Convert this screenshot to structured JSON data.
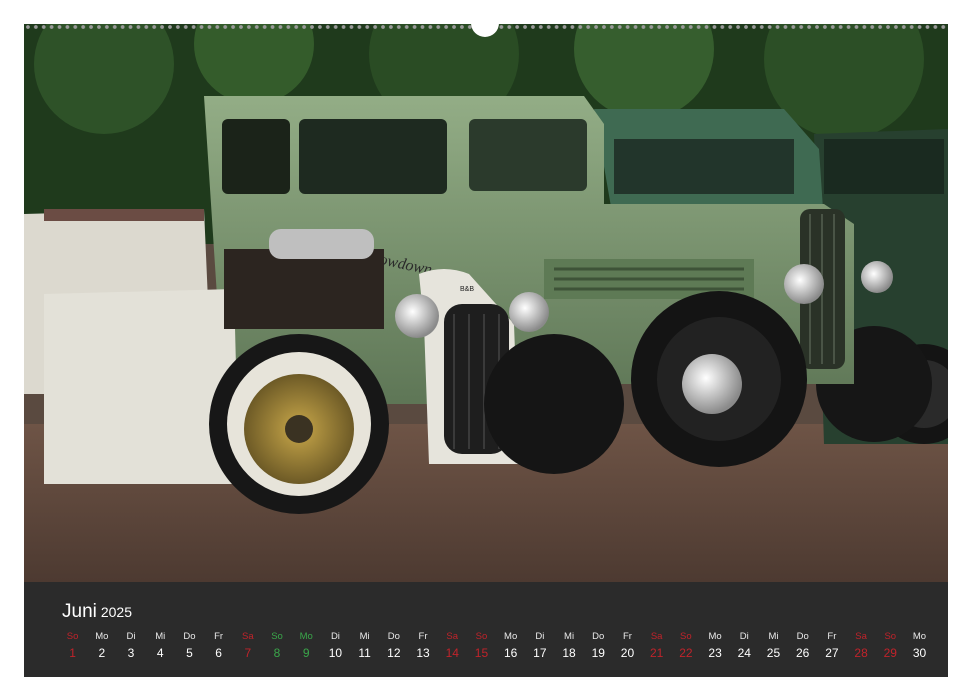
{
  "calendar": {
    "month": "Juni",
    "year": "2025",
    "days": [
      {
        "wd": "So",
        "d": "1",
        "kind": "sun"
      },
      {
        "wd": "Mo",
        "d": "2",
        "kind": "week"
      },
      {
        "wd": "Di",
        "d": "3",
        "kind": "week"
      },
      {
        "wd": "Mi",
        "d": "4",
        "kind": "week"
      },
      {
        "wd": "Do",
        "d": "5",
        "kind": "week"
      },
      {
        "wd": "Fr",
        "d": "6",
        "kind": "week"
      },
      {
        "wd": "Sa",
        "d": "7",
        "kind": "sat"
      },
      {
        "wd": "So",
        "d": "8",
        "kind": "hol"
      },
      {
        "wd": "Mo",
        "d": "9",
        "kind": "hol"
      },
      {
        "wd": "Di",
        "d": "10",
        "kind": "week"
      },
      {
        "wd": "Mi",
        "d": "11",
        "kind": "week"
      },
      {
        "wd": "Do",
        "d": "12",
        "kind": "week"
      },
      {
        "wd": "Fr",
        "d": "13",
        "kind": "week"
      },
      {
        "wd": "Sa",
        "d": "14",
        "kind": "sat"
      },
      {
        "wd": "So",
        "d": "15",
        "kind": "sun"
      },
      {
        "wd": "Mo",
        "d": "16",
        "kind": "week"
      },
      {
        "wd": "Di",
        "d": "17",
        "kind": "week"
      },
      {
        "wd": "Mi",
        "d": "18",
        "kind": "week"
      },
      {
        "wd": "Do",
        "d": "19",
        "kind": "week"
      },
      {
        "wd": "Fr",
        "d": "20",
        "kind": "week"
      },
      {
        "wd": "Sa",
        "d": "21",
        "kind": "sat"
      },
      {
        "wd": "So",
        "d": "22",
        "kind": "sun"
      },
      {
        "wd": "Mo",
        "d": "23",
        "kind": "week"
      },
      {
        "wd": "Di",
        "d": "24",
        "kind": "week"
      },
      {
        "wd": "Mi",
        "d": "25",
        "kind": "week"
      },
      {
        "wd": "Do",
        "d": "26",
        "kind": "week"
      },
      {
        "wd": "Fr",
        "d": "27",
        "kind": "week"
      },
      {
        "wd": "Sa",
        "d": "28",
        "kind": "sat"
      },
      {
        "wd": "So",
        "d": "29",
        "kind": "sun"
      },
      {
        "wd": "Mo",
        "d": "30",
        "kind": "week"
      }
    ]
  },
  "photo": {
    "door_lettering": "Lowdown",
    "grille_badge": "B&B"
  },
  "colors": {
    "calendar_bg": "#2b2b2b",
    "weekend_red": "#c0232b",
    "holiday_green": "#3aa64a",
    "car_green": "#7f9a72",
    "hotrod_white": "#e3e1d8"
  }
}
